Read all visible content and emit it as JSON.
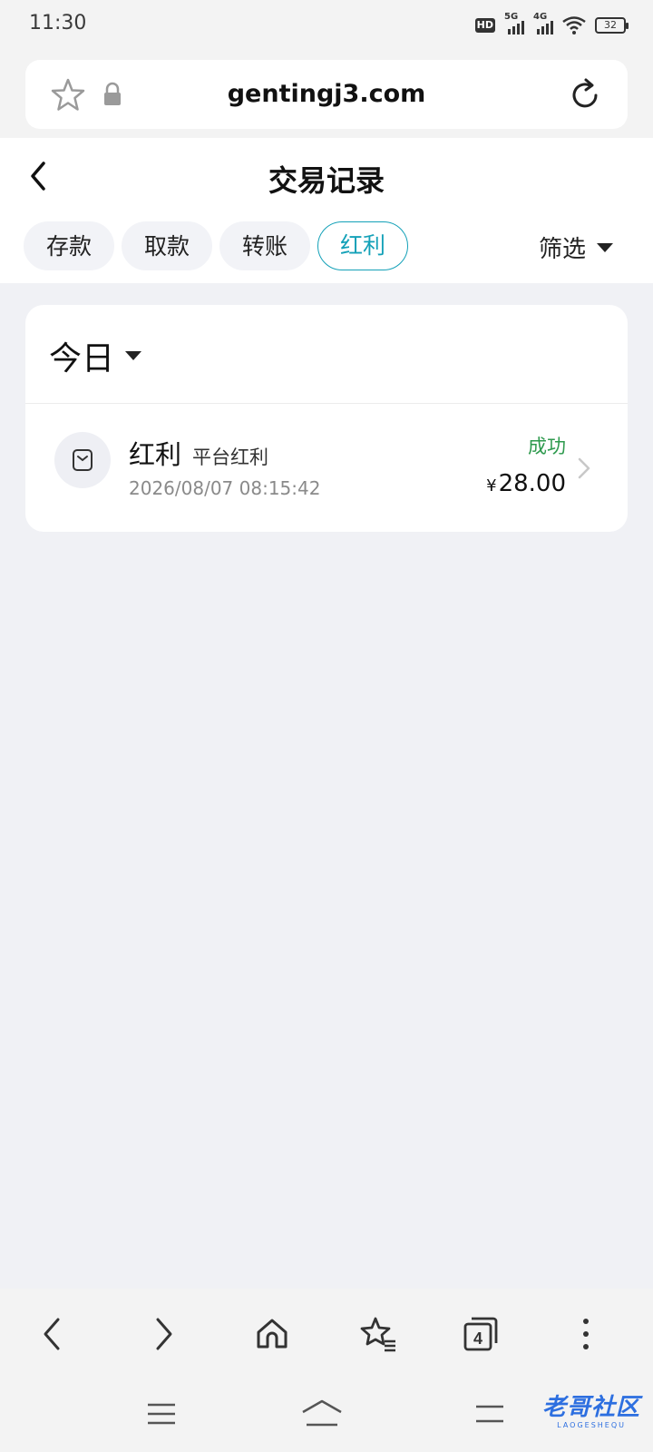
{
  "status_bar": {
    "time": "11:30",
    "hd_badge": "HD",
    "sim1_label": "5G",
    "sim2_label": "4G",
    "battery": "32"
  },
  "browser": {
    "url": "gentingj3.com"
  },
  "page": {
    "title": "交易记录",
    "tabs": [
      {
        "label": "存款",
        "active": false
      },
      {
        "label": "取款",
        "active": false
      },
      {
        "label": "转账",
        "active": false
      },
      {
        "label": "红利",
        "active": true
      }
    ],
    "filter_label": "筛选"
  },
  "records": {
    "period_label": "今日",
    "items": [
      {
        "title": "红利",
        "subtitle": "平台红利",
        "datetime": "2026/08/07 08:15:42",
        "status": "成功",
        "currency": "¥",
        "amount": "28.00"
      }
    ]
  },
  "bottom_toolbar": {
    "tab_count": "4"
  },
  "watermark": {
    "text": "老哥社区",
    "sub": "LAOGESHEQU"
  },
  "colors": {
    "accent": "#14a1b8",
    "success": "#2e9a4e",
    "page_bg": "#f0f1f5"
  }
}
